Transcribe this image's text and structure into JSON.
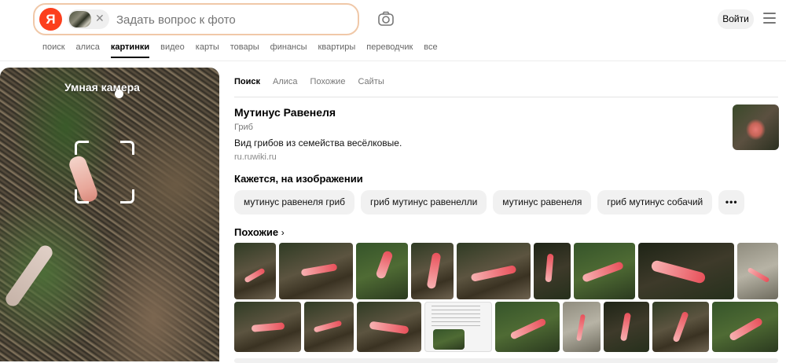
{
  "header": {
    "logo_letter": "Я",
    "search_placeholder": "Задать вопрос к фото",
    "clear_symbol": "✕",
    "login_label": "Войти",
    "nav_tabs": [
      "поиск",
      "алиса",
      "картинки",
      "видео",
      "карты",
      "товары",
      "финансы",
      "квартиры",
      "переводчик",
      "все"
    ],
    "active_tab": "картинки"
  },
  "smart_camera": {
    "label": "Умная камера"
  },
  "result": {
    "tabs": [
      "Поиск",
      "Алиса",
      "Похожие",
      "Сайты"
    ],
    "active_tab": "Поиск",
    "entity": {
      "title": "Мутинус Равенеля",
      "type": "Гриб",
      "description": "Вид грибов из семейства весёлковые.",
      "source": "ru.ruwiki.ru"
    },
    "seems_title": "Кажется, на изображении",
    "chips": [
      "мутинус равенеля гриб",
      "гриб мутинус равенелли",
      "мутинус равенеля",
      "гриб мутинус собачий"
    ],
    "more_symbol": "•••",
    "similar_title": "Похожие",
    "similar_chevron": "›"
  },
  "colors": {
    "brand_red": "#fc3f1d",
    "search_border": "#f0c8a8",
    "chip_bg": "#f1f1f1"
  },
  "icons": [
    "camera-icon",
    "menu-icon",
    "close-icon",
    "chevron-right-icon",
    "more-icon"
  ]
}
